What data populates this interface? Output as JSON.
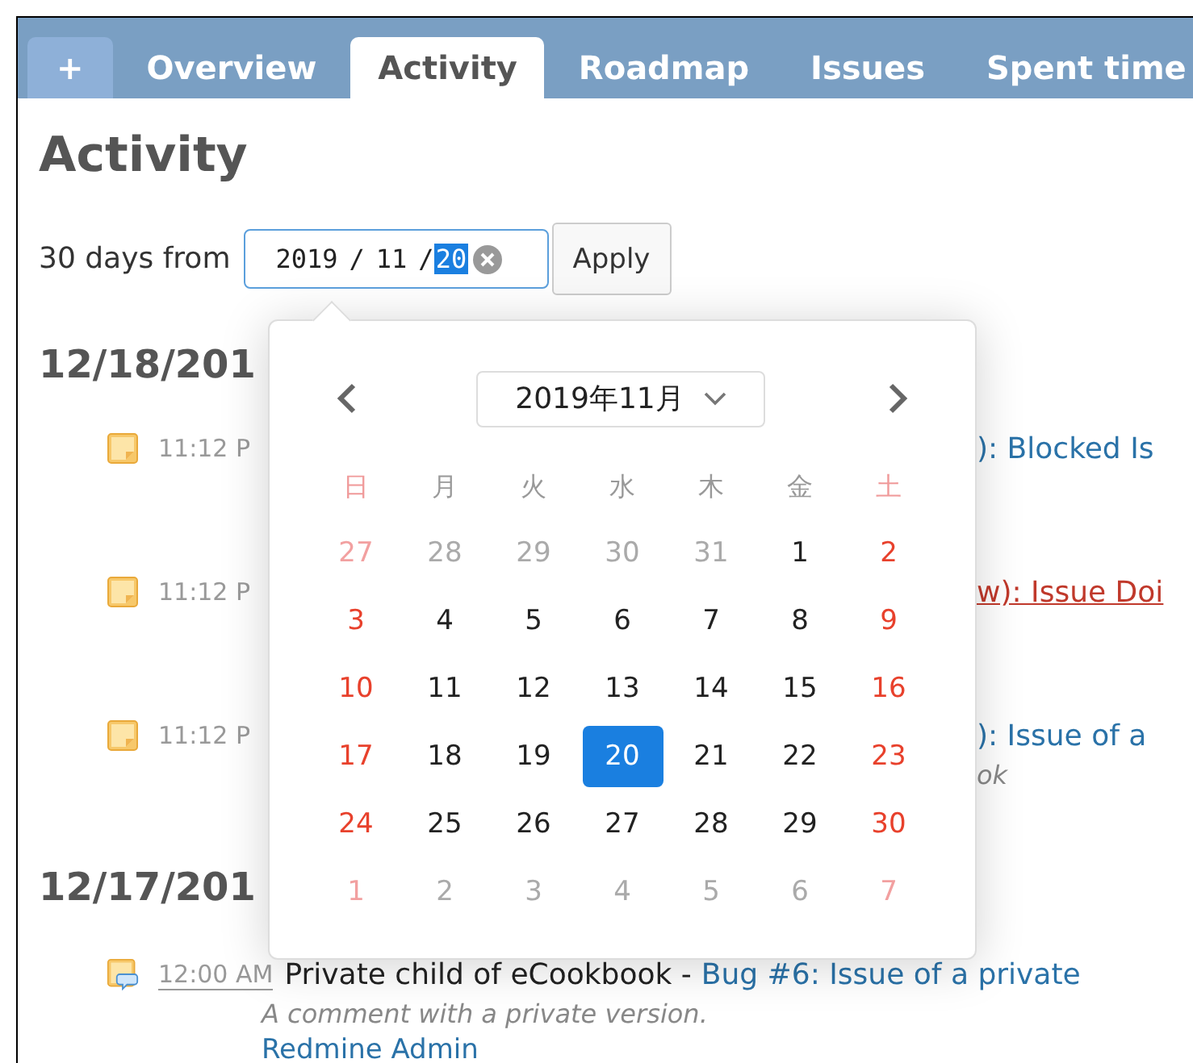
{
  "tabs": [
    {
      "label": "+",
      "kind": "new",
      "selected": false
    },
    {
      "label": "Overview",
      "kind": "page",
      "selected": false
    },
    {
      "label": "Activity",
      "kind": "page",
      "selected": true
    },
    {
      "label": "Roadmap",
      "kind": "page",
      "selected": false
    },
    {
      "label": "Issues",
      "kind": "page",
      "selected": false
    },
    {
      "label": "Spent time",
      "kind": "page",
      "selected": false
    }
  ],
  "page_title": "Activity",
  "filter": {
    "label": "30 days from",
    "date_field": {
      "separator": "/",
      "segments": [
        {
          "text": "2019",
          "selected": false
        },
        {
          "text": "11",
          "selected": false
        },
        {
          "text": "20",
          "selected": true
        }
      ]
    },
    "apply_button": "Apply"
  },
  "days": [
    {
      "heading": "12/18/201",
      "entries": [
        {
          "kind": "note",
          "time": "11:12 P",
          "title": "): Blocked Is",
          "hovered": false
        },
        {
          "kind": "note",
          "time": "11:12 P",
          "title": "w): Issue Doi",
          "hovered": true
        },
        {
          "kind": "note",
          "time": "11:12 P",
          "title": "): Issue of a",
          "description": "ok",
          "hovered": false
        }
      ]
    },
    {
      "heading": "12/17/201",
      "entries": [
        {
          "kind": "comment",
          "time": "12:00 AM",
          "project": "Private child of eCookbook - ",
          "title": "Bug #6: Issue of a private",
          "description": "A comment with a private version.",
          "author": "Redmine Admin",
          "hovered": false
        }
      ]
    }
  ],
  "date_picker": {
    "month_label": "2019年11月",
    "weekdays": [
      "日",
      "月",
      "火",
      "水",
      "木",
      "金",
      "土"
    ],
    "weeks": [
      [
        {
          "day": "27",
          "kind": "other",
          "selected": false
        },
        {
          "day": "28",
          "kind": "other",
          "selected": false
        },
        {
          "day": "29",
          "kind": "other",
          "selected": false
        },
        {
          "day": "30",
          "kind": "other",
          "selected": false
        },
        {
          "day": "31",
          "kind": "other",
          "selected": false
        },
        {
          "day": "1",
          "kind": "current",
          "selected": false
        },
        {
          "day": "2",
          "kind": "current",
          "selected": false
        }
      ],
      [
        {
          "day": "3",
          "kind": "current",
          "selected": false
        },
        {
          "day": "4",
          "kind": "current",
          "selected": false
        },
        {
          "day": "5",
          "kind": "current",
          "selected": false
        },
        {
          "day": "6",
          "kind": "current",
          "selected": false
        },
        {
          "day": "7",
          "kind": "current",
          "selected": false
        },
        {
          "day": "8",
          "kind": "current",
          "selected": false
        },
        {
          "day": "9",
          "kind": "current",
          "selected": false
        }
      ],
      [
        {
          "day": "10",
          "kind": "current",
          "selected": false
        },
        {
          "day": "11",
          "kind": "current",
          "selected": false
        },
        {
          "day": "12",
          "kind": "current",
          "selected": false
        },
        {
          "day": "13",
          "kind": "current",
          "selected": false
        },
        {
          "day": "14",
          "kind": "current",
          "selected": false
        },
        {
          "day": "15",
          "kind": "current",
          "selected": false
        },
        {
          "day": "16",
          "kind": "current",
          "selected": false
        }
      ],
      [
        {
          "day": "17",
          "kind": "current",
          "selected": false
        },
        {
          "day": "18",
          "kind": "current",
          "selected": false
        },
        {
          "day": "19",
          "kind": "current",
          "selected": false
        },
        {
          "day": "20",
          "kind": "current",
          "selected": true
        },
        {
          "day": "21",
          "kind": "current",
          "selected": false
        },
        {
          "day": "22",
          "kind": "current",
          "selected": false
        },
        {
          "day": "23",
          "kind": "current",
          "selected": false
        }
      ],
      [
        {
          "day": "24",
          "kind": "current",
          "selected": false
        },
        {
          "day": "25",
          "kind": "current",
          "selected": false
        },
        {
          "day": "26",
          "kind": "current",
          "selected": false
        },
        {
          "day": "27",
          "kind": "current",
          "selected": false
        },
        {
          "day": "28",
          "kind": "current",
          "selected": false
        },
        {
          "day": "29",
          "kind": "current",
          "selected": false
        },
        {
          "day": "30",
          "kind": "current",
          "selected": false
        }
      ],
      [
        {
          "day": "1",
          "kind": "other",
          "selected": false
        },
        {
          "day": "2",
          "kind": "other",
          "selected": false
        },
        {
          "day": "3",
          "kind": "other",
          "selected": false
        },
        {
          "day": "4",
          "kind": "other",
          "selected": false
        },
        {
          "day": "5",
          "kind": "other",
          "selected": false
        },
        {
          "day": "6",
          "kind": "other",
          "selected": false
        },
        {
          "day": "7",
          "kind": "other",
          "selected": false
        }
      ]
    ]
  }
}
